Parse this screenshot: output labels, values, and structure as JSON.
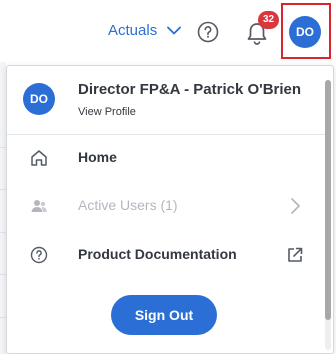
{
  "header": {
    "scenario_label": "Actuals",
    "notifications_count": "32",
    "avatar_initials": "DO"
  },
  "profile": {
    "initials": "DO",
    "name": "Director FP&A - Patrick O'Brien",
    "link_label": "View Profile"
  },
  "menu": {
    "items": [
      {
        "label": "Home",
        "icon": "home-icon",
        "enabled": true
      },
      {
        "label": "Active Users (1)",
        "icon": "users-icon",
        "enabled": false,
        "trailing_icon": "chevron-right-icon"
      },
      {
        "label": "Product Documentation",
        "icon": "help-circle-icon",
        "enabled": true,
        "trailing_icon": "external-link-icon"
      }
    ],
    "sign_out_label": "Sign Out"
  },
  "colors": {
    "accent": "#2b6fd6",
    "badge": "#d9363e",
    "highlight_border": "#d9262e",
    "text_primary": "#333840",
    "text_disabled": "#b3b7bd"
  }
}
